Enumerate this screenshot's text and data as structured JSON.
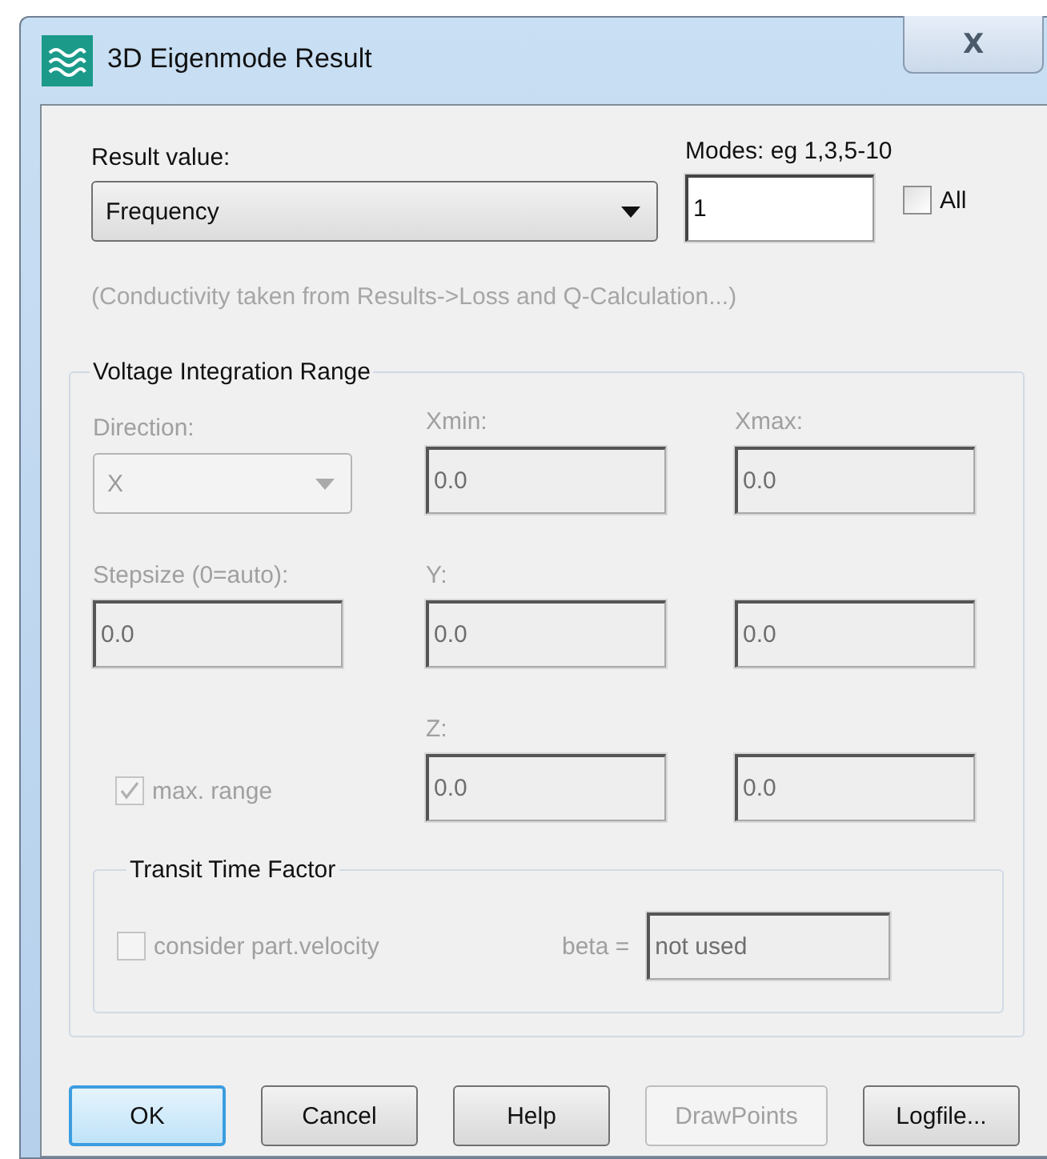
{
  "window": {
    "title": "3D Eigenmode Result",
    "close": "X"
  },
  "result_value": {
    "label": "Result value:",
    "value": "Frequency"
  },
  "modes": {
    "label": "Modes: eg 1,3,5-10",
    "value": "1"
  },
  "all_checkbox": {
    "label": "All",
    "checked": false
  },
  "note": "(Conductivity taken from Results->Loss and Q-Calculation...)",
  "voltage_range": {
    "title": "Voltage Integration Range",
    "disabled": true,
    "rows": [
      {
        "cells": [
          {
            "kind": "combo",
            "label": "Direction:",
            "value": "X"
          },
          {
            "kind": "field",
            "label": "Xmin:",
            "value": "0.0"
          },
          {
            "kind": "field",
            "label": "Xmax:",
            "value": "0.0"
          }
        ]
      },
      {
        "cells": [
          {
            "kind": "field",
            "label": "Stepsize (0=auto):",
            "value": "0.0"
          },
          {
            "kind": "field",
            "label": "Y:",
            "value": "0.0"
          },
          {
            "kind": "field",
            "value": "0.0"
          }
        ]
      },
      {
        "cells": [
          {
            "kind": "checkbox",
            "label": "max. range",
            "checked": true
          },
          {
            "kind": "field",
            "label": "Z:",
            "value": "0.0"
          },
          {
            "kind": "field",
            "value": "0.0"
          }
        ]
      }
    ]
  },
  "transit_time": {
    "title": "Transit Time Factor",
    "disabled": true,
    "checkbox": {
      "label": "consider part.velocity",
      "checked": false
    },
    "beta": {
      "label": "beta =",
      "value": "not used"
    }
  },
  "buttons": [
    {
      "label": "OK",
      "default": true,
      "disabled": false
    },
    {
      "label": "Cancel",
      "default": false,
      "disabled": false
    },
    {
      "label": "Help",
      "default": false,
      "disabled": false
    },
    {
      "label": "DrawPoints",
      "default": false,
      "disabled": true
    },
    {
      "label": "Logfile...",
      "default": false,
      "disabled": false
    }
  ]
}
